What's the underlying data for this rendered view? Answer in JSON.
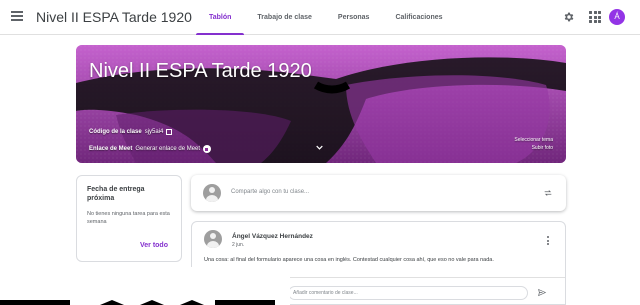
{
  "header": {
    "title": "Nivel II ESPA Tarde 1920",
    "tabs": [
      {
        "label": "Tablón"
      },
      {
        "label": "Trabajo de clase"
      },
      {
        "label": "Personas"
      },
      {
        "label": "Calificaciones"
      }
    ],
    "avatar_letter": "Á",
    "accent_color": "#8430ce"
  },
  "banner": {
    "title": "Nivel II ESPA Tarde 1920",
    "code_label": "Código de la clase",
    "code_value": "sjy5ai4",
    "meet_label": "Enlace de Meet",
    "meet_action": "Generar enlace de Meet",
    "select_theme": "Seleccionar tema",
    "upload_photo": "Subir foto"
  },
  "upcoming": {
    "title": "Fecha de entrega próxima",
    "text": "No tienes ninguna tarea para esta semana",
    "view_all": "Ver todo"
  },
  "share": {
    "placeholder": "Comparte algo con tu clase..."
  },
  "post": {
    "author": "Ángel Vázquez Hernández",
    "date": "2 jun.",
    "body": "Una cosa: al final del formulario aparece una cosa en inglés. Contestad cualquier cosa ahí, que eso no vale para nada.",
    "comment_placeholder": "Añadir comentario de clase..."
  }
}
